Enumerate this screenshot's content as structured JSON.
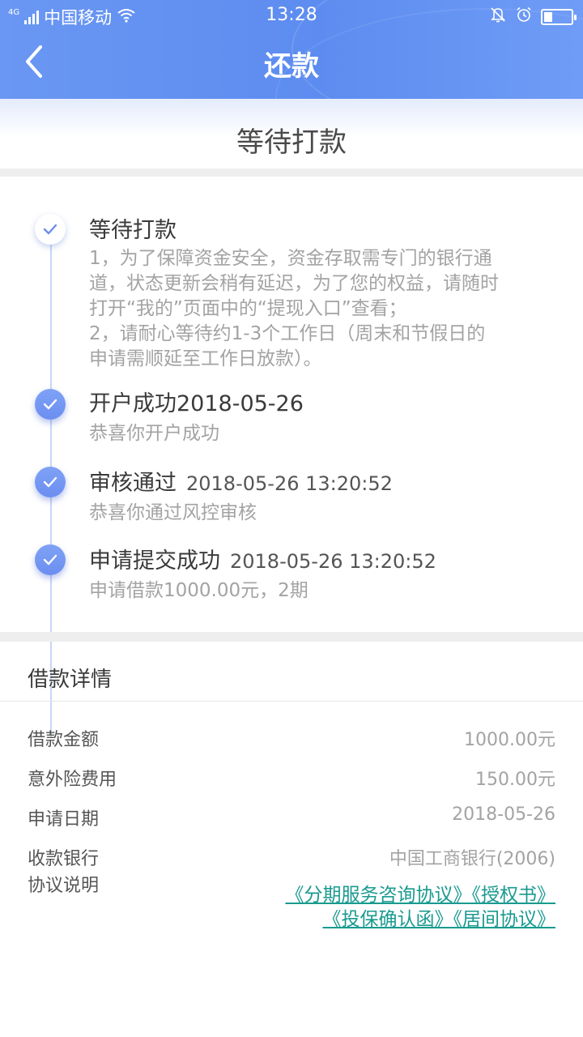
{
  "status_bar": {
    "network": "4G",
    "carrier": "中国移动",
    "time": "13:28",
    "battery_level": 0.3
  },
  "nav": {
    "title": "还款",
    "back_icon": "chevron-left-icon"
  },
  "status_header": "等待打款",
  "steps": [
    {
      "title": "等待打款",
      "time": "",
      "state": "pending",
      "desc_lines": [
        "1，为了保障资金安全，资金存取需专门的银行通",
        "道，状态更新会稍有延迟，为了您的权益，请随时",
        "打开“我的”页面中的“提现入口”查看；",
        "2，请耐心等待约1-3个工作日（周末和节假日的",
        "申请需顺延至工作日放款）。"
      ]
    },
    {
      "title": "开户成功2018-05-26",
      "time": "",
      "state": "done",
      "desc_lines": [
        "恭喜你开户成功"
      ]
    },
    {
      "title": "审核通过",
      "time": "2018-05-26 13:20:52",
      "state": "done",
      "desc_lines": [
        "恭喜你通过风控审核"
      ]
    },
    {
      "title": "申请提交成功",
      "time": "2018-05-26 13:20:52",
      "state": "done",
      "desc_lines": [
        "申请借款1000.00元，2期"
      ]
    }
  ],
  "details": {
    "title": "借款详情",
    "rows": [
      {
        "label": "借款金额",
        "value": "1000.00元"
      },
      {
        "label": "意外险费用",
        "value": "150.00元"
      },
      {
        "label": "申请日期",
        "value": "2018-05-26"
      },
      {
        "label": "收款银行",
        "value": "中国工商银行(2006)"
      },
      {
        "label": "协议说明",
        "value": ""
      }
    ],
    "agreements": [
      "《分期服务咨询协议》",
      "《授权书》",
      "《投保确认函》",
      "《居间协议》"
    ]
  },
  "colors": {
    "header": "#6a97f3",
    "link": "#1a9a8f",
    "check_dot": "#6b8ef0"
  }
}
